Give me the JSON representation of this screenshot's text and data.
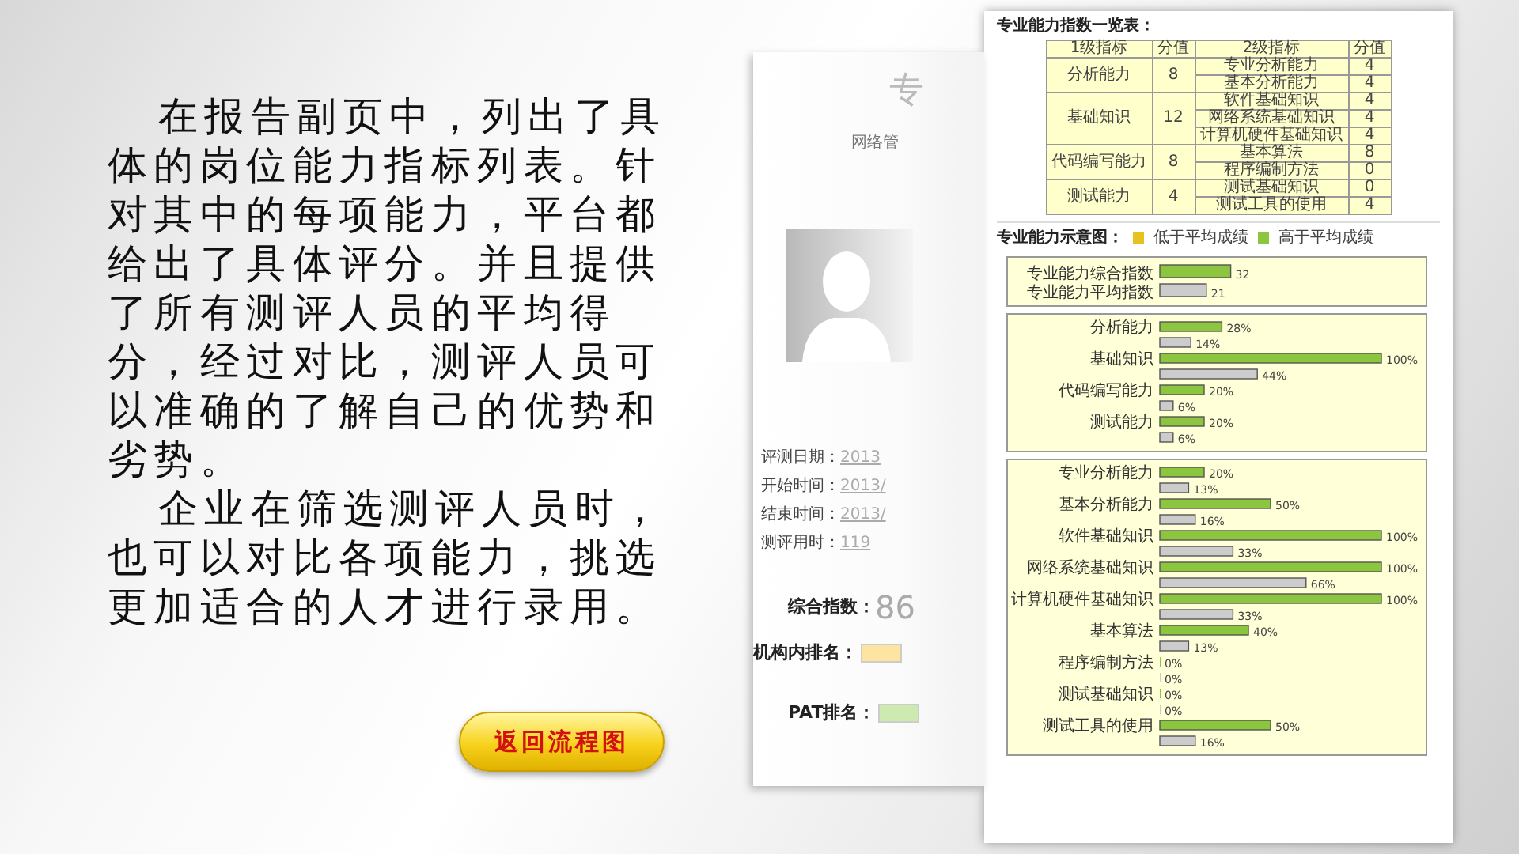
{
  "description": {
    "paragraphs": [
      "在报告副页中，列出了具体的岗位能力指标列表。针对其中的每项能力，平台都给出了具体评分。并且提供了所有测评人员的平均得分，经过对比，测评人员可以准确的了解自己的优势和劣势。",
      "企业在筛选测评人员时，也可以对比各项能力，挑选更加适合的人才进行录用。"
    ]
  },
  "back_button": {
    "label": "返回流程图"
  },
  "report_preview": {
    "title": "专",
    "subtitle": "网络管",
    "fields": [
      {
        "label": "评测日期：",
        "value": "2013"
      },
      {
        "label": "开始时间：",
        "value": "2013/"
      },
      {
        "label": "结束时间：",
        "value": "2013/"
      },
      {
        "label": "测评用时：",
        "value": "119"
      }
    ],
    "index": {
      "label": "综合指数：",
      "value": "86"
    },
    "rankings": [
      {
        "label": "机构内排名：",
        "color": "#fde4a0"
      },
      {
        "label": "PAT排名：",
        "color": "#cdeab0"
      }
    ]
  },
  "report_page": {
    "table_title": "专业能力指数一览表：",
    "table": {
      "columns": [
        "1级指标",
        "分值",
        "2级指标",
        "分值"
      ],
      "groups": [
        {
          "name": "分析能力",
          "score": "8",
          "items": [
            {
              "name": "专业分析能力",
              "score": "4"
            },
            {
              "name": "基本分析能力",
              "score": "4"
            }
          ]
        },
        {
          "name": "基础知识",
          "score": "12",
          "items": [
            {
              "name": "软件基础知识",
              "score": "4"
            },
            {
              "name": "网络系统基础知识",
              "score": "4"
            },
            {
              "name": "计算机硬件基础知识",
              "score": "4"
            }
          ]
        },
        {
          "name": "代码编写能力",
          "score": "8",
          "items": [
            {
              "name": "基本算法",
              "score": "8"
            },
            {
              "name": "程序编制方法",
              "score": "0"
            }
          ]
        },
        {
          "name": "测试能力",
          "score": "4",
          "items": [
            {
              "name": "测试基础知识",
              "score": "0"
            },
            {
              "name": "测试工具的使用",
              "score": "4"
            }
          ]
        }
      ]
    },
    "chart_title": "专业能力示意图：",
    "legend": [
      {
        "label": "低于平均成绩",
        "color": "#e8c020"
      },
      {
        "label": "高于平均成绩",
        "color": "#8cc63f"
      }
    ],
    "charts": [
      {
        "chart_data": {
          "type": "bar",
          "orientation": "horizontal",
          "categories": [
            "专业能力综合指数",
            "专业能力平均指数"
          ],
          "series": [
            {
              "color": "#8cc63f",
              "values": [
                32,
                null
              ]
            },
            {
              "color": "#cccccc",
              "values": [
                null,
                21
              ]
            }
          ],
          "data_labels": true
        }
      },
      {
        "chart_data": {
          "type": "bar",
          "orientation": "horizontal",
          "categories": [
            "分析能力",
            "基础知识",
            "代码编写能力",
            "测试能力"
          ],
          "series": [
            {
              "color": "#8cc63f",
              "values": [
                28,
                100,
                20,
                20
              ],
              "value_labels": [
                "28%",
                "100%",
                "20%",
                "20%"
              ]
            },
            {
              "color": "#cccccc",
              "values": [
                14,
                44,
                6,
                6
              ],
              "value_labels": [
                "14%",
                "44%",
                "6%",
                "6%"
              ]
            }
          ]
        }
      },
      {
        "chart_data": {
          "type": "bar",
          "orientation": "horizontal",
          "categories": [
            "专业分析能力",
            "基本分析能力",
            "软件基础知识",
            "网络系统基础知识",
            "计算机硬件基础知识",
            "基本算法",
            "程序编制方法",
            "测试基础知识",
            "测试工具的使用"
          ],
          "series": [
            {
              "color": "#8cc63f",
              "values": [
                20,
                50,
                100,
                100,
                100,
                40,
                0,
                0,
                50
              ],
              "value_labels": [
                "20%",
                "50%",
                "100%",
                "100%",
                "100%",
                "40%",
                "0%",
                "0%",
                "50%"
              ]
            },
            {
              "color": "#cccccc",
              "values": [
                13,
                16,
                33,
                66,
                33,
                13,
                0,
                0,
                16
              ],
              "value_labels": [
                "13%",
                "16%",
                "33%",
                "66%",
                "33%",
                "13%",
                "0%",
                "0%",
                "16%"
              ]
            }
          ]
        }
      }
    ]
  }
}
